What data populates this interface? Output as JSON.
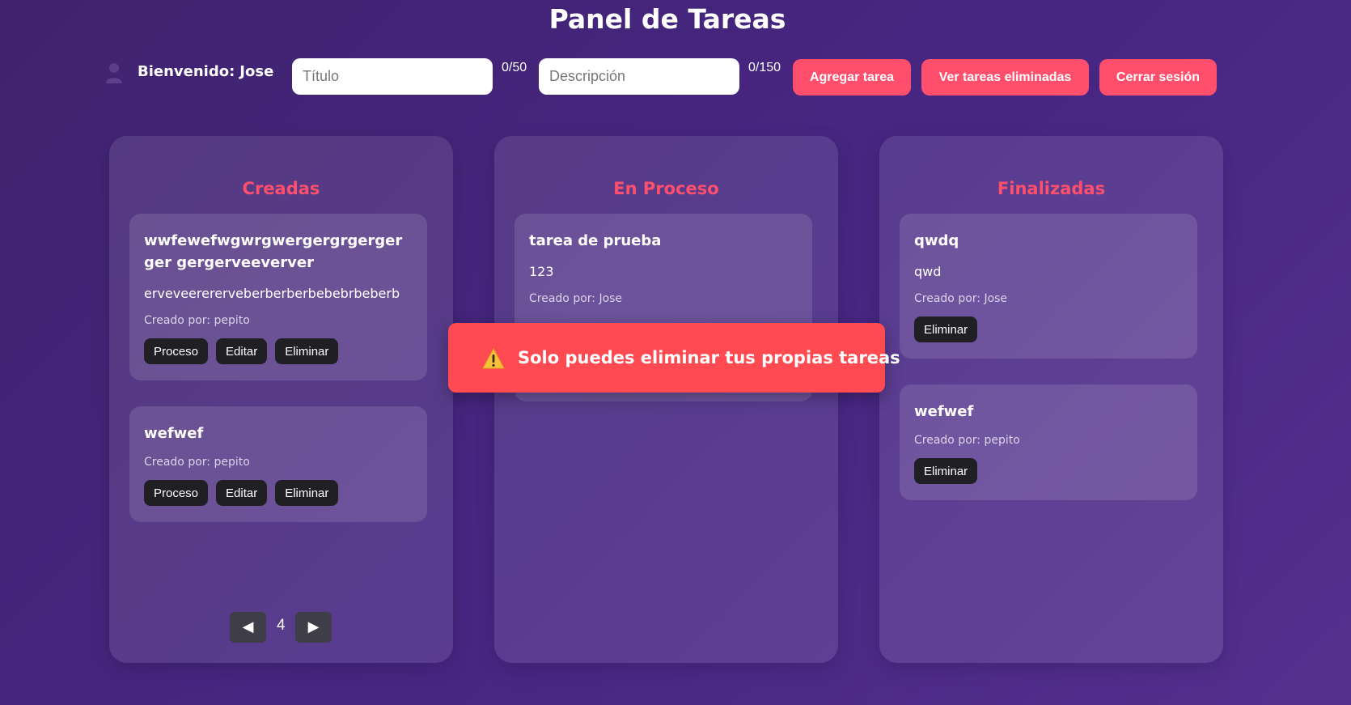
{
  "app": {
    "title": "Panel de Tareas"
  },
  "header": {
    "user_icon": "user-icon",
    "welcome_label": "Bienvenido:",
    "username": "Jose",
    "title_input": {
      "placeholder": "Título",
      "value": "",
      "counter": "0/50"
    },
    "description_input": {
      "placeholder": "Descripción",
      "value": "",
      "counter": "0/150"
    },
    "buttons": {
      "add": "Agregar tarea",
      "deleted": "Ver tareas eliminadas",
      "logout": "Cerrar sesión"
    },
    "accent_color": "#ff4f6c"
  },
  "columns": {
    "created": {
      "title": "Creadas",
      "tasks": [
        {
          "title": "wwfewefwgwrgwergergrgergerger gergerveeverver",
          "description": "erveveerererveberberberbebebrbeberb",
          "author": "Creado por: pepito",
          "actions": [
            "Proceso",
            "Editar",
            "Eliminar"
          ]
        },
        {
          "title": "wefwef",
          "author": "Creado por: pepito",
          "actions": [
            "Proceso",
            "Editar",
            "Eliminar"
          ]
        }
      ],
      "pagination": {
        "prev_icon": "◀",
        "page": "4",
        "next_icon": "▶"
      }
    },
    "in_progress": {
      "title": "En Proceso",
      "tasks": [
        {
          "title": "tarea de prueba",
          "description": "123",
          "author": "Creado por: Jose"
        }
      ]
    },
    "done": {
      "title": "Finalizadas",
      "tasks": [
        {
          "title": "qwdq",
          "description": "qwd",
          "author": "Creado por: Jose",
          "actions": [
            "Eliminar"
          ]
        },
        {
          "title": "wefwef",
          "author": "Creado por: pepito",
          "actions": [
            "Eliminar"
          ]
        }
      ]
    }
  },
  "toast": {
    "icon": "warning-icon",
    "message": "Solo puedes eliminar tus propias tareas",
    "color": "#ff4a52"
  }
}
